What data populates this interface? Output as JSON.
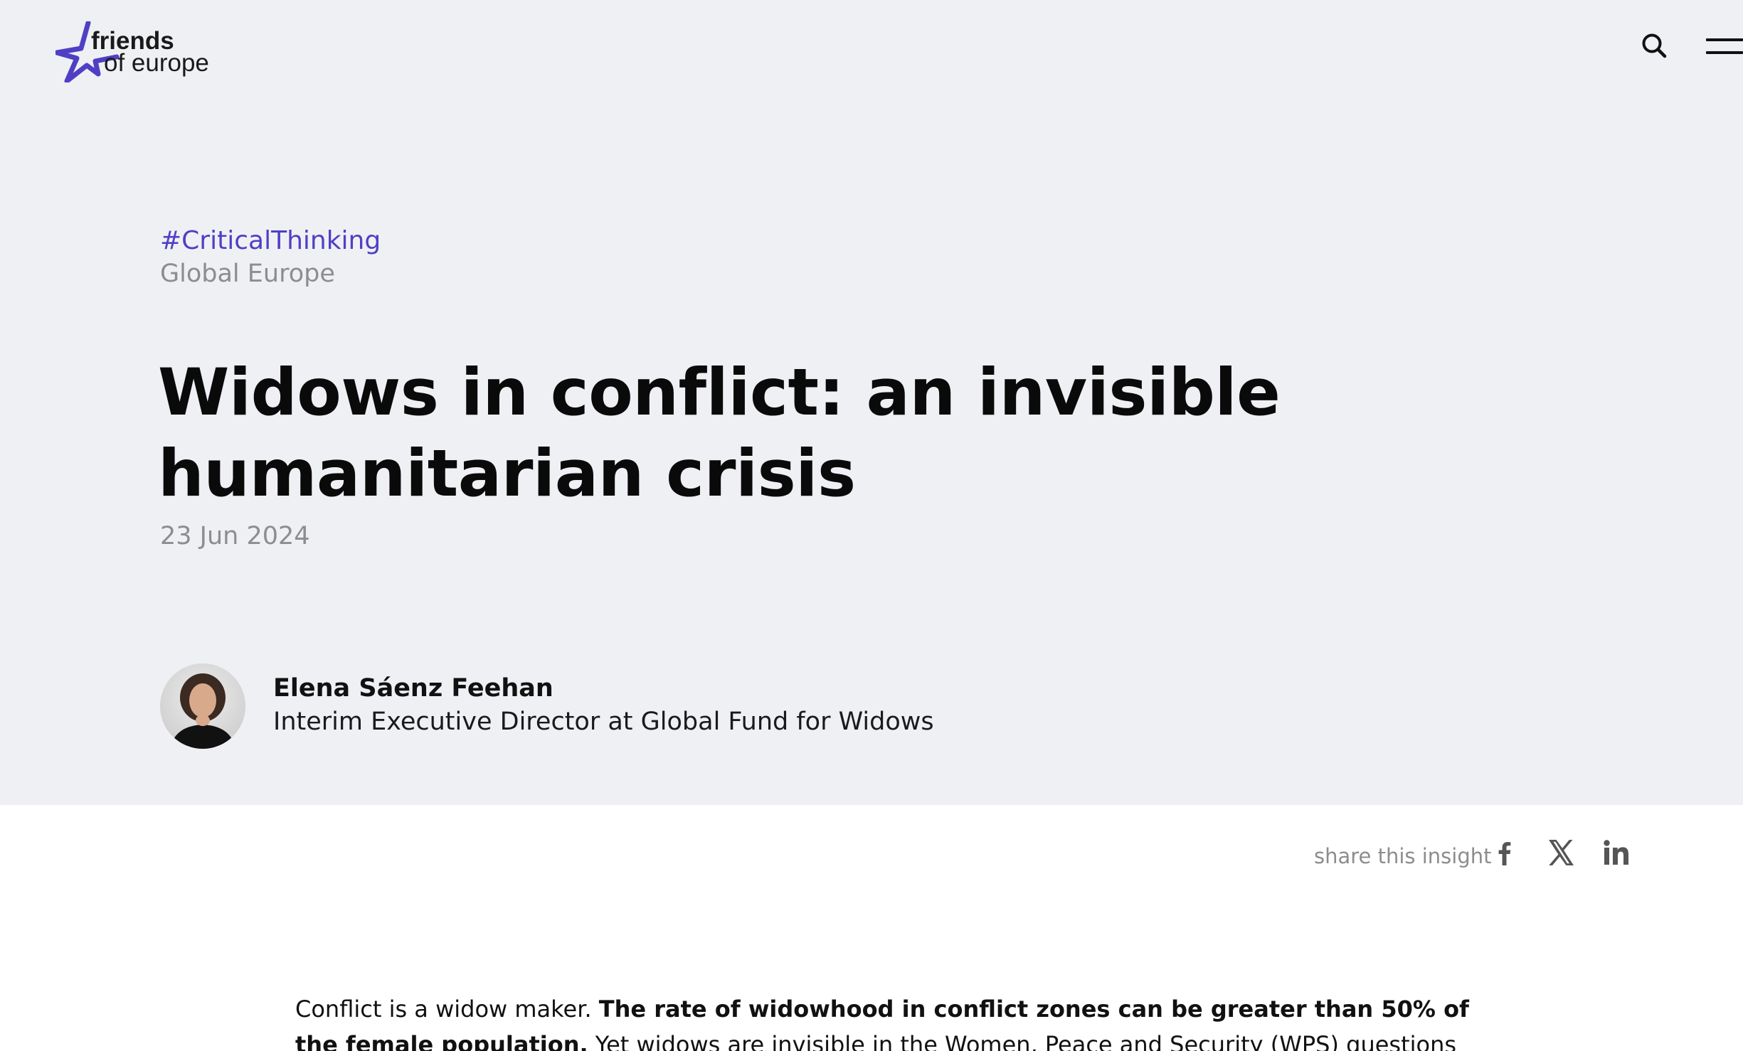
{
  "header": {
    "logo_line1": "friends",
    "logo_line2": "of europe",
    "logo_icon": "star-logo-icon",
    "search_icon": "search-icon",
    "menu_icon": "hamburger-menu-icon"
  },
  "article": {
    "hashtag": "#CriticalThinking",
    "category": "Global Europe",
    "title": "Widows in conflict: an invisible humanitarian crisis",
    "date": "23 Jun 2024"
  },
  "author": {
    "name": "Elena Sáenz Feehan",
    "role": "Interim Executive Director at Global Fund for Widows"
  },
  "share": {
    "label": "share this insight",
    "icons": [
      "facebook-icon",
      "x-icon",
      "linkedin-icon"
    ]
  },
  "body": {
    "p1_intro": "Conflict is a widow maker. ",
    "p1_bold": "The rate of widowhood in conflict zones can be greater than 50% of the female population.",
    "p1_rest": " Yet widows are invisible in the Women, Peace and Security (WPS) questions and receive"
  },
  "colors": {
    "accent": "#4f3fc4",
    "hero_background": "#eff0f4",
    "muted_text": "#8d8d8d"
  }
}
